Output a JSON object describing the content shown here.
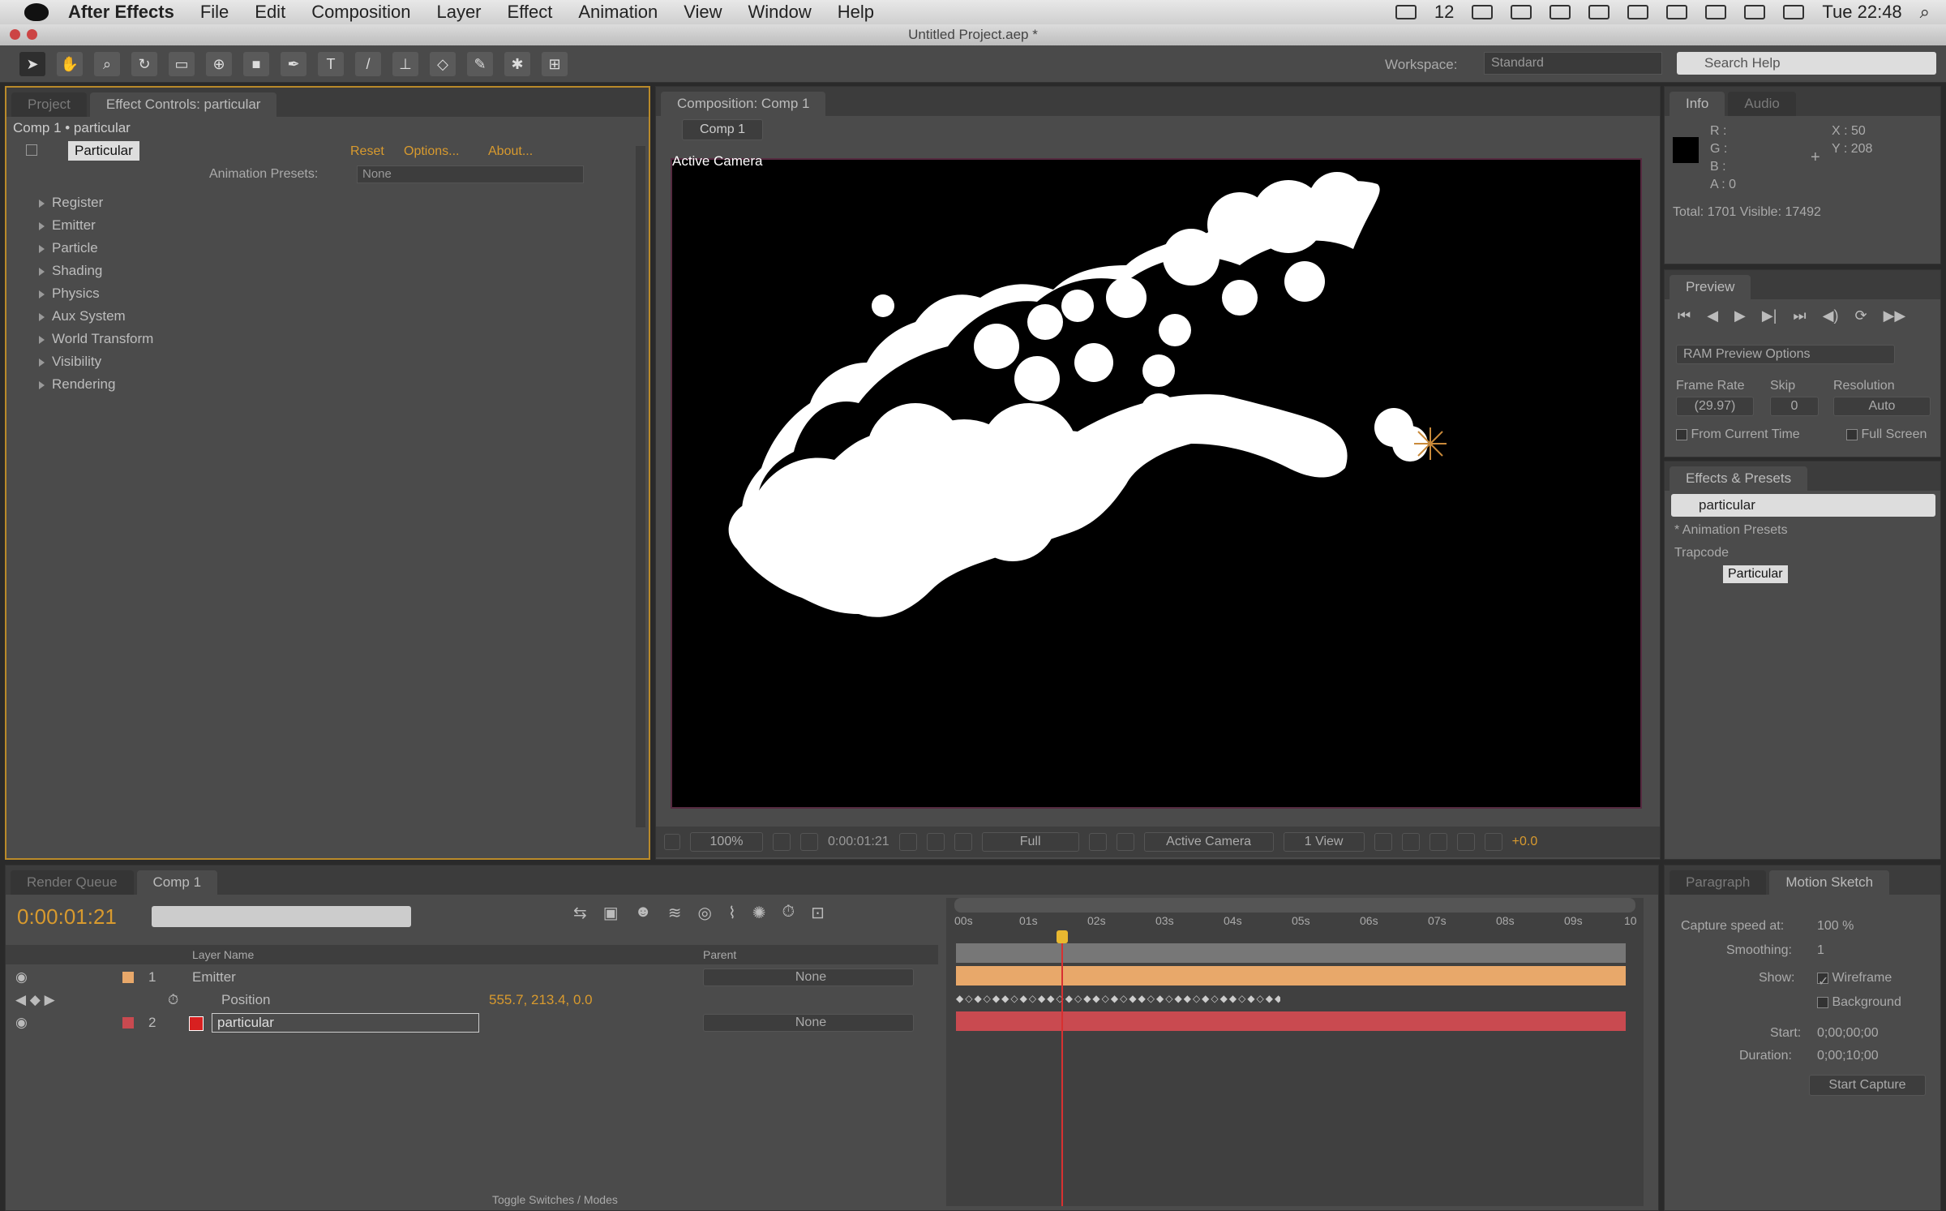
{
  "menubar": {
    "app": "After Effects",
    "items": [
      "File",
      "Edit",
      "Composition",
      "Layer",
      "Effect",
      "Animation",
      "View",
      "Window",
      "Help"
    ],
    "clock": "Tue 22:48",
    "count": "12"
  },
  "window": {
    "title": "Untitled Project.aep *"
  },
  "workspace": {
    "label": "Workspace:",
    "value": "Standard",
    "search_placeholder": "Search Help"
  },
  "left_panel": {
    "tab_project": "Project",
    "tab_effect": "Effect Controls: particular",
    "breadcrumb": "Comp 1 • particular",
    "effect_name": "Particular",
    "reset": "Reset",
    "options": "Options...",
    "about": "About...",
    "presets_label": "Animation Presets:",
    "presets_value": "None",
    "groups": [
      "Register",
      "Emitter",
      "Particle",
      "Shading",
      "Physics",
      "Aux System",
      "World Transform",
      "Visibility",
      "Rendering"
    ]
  },
  "comp_panel": {
    "tab": "Composition: Comp 1",
    "subtab": "Comp 1",
    "camera_label": "Active Camera",
    "zoom": "100%",
    "timecode": "0:00:01:21",
    "resolution": "Full",
    "camera": "Active Camera",
    "views": "1 View",
    "offset": "+0.0"
  },
  "info": {
    "tab_info": "Info",
    "tab_audio": "Audio",
    "r": "R :",
    "g": "G :",
    "b": "B :",
    "a": "A : 0",
    "x": "X : 50",
    "y": "Y : 208",
    "total": "Total: 1701   Visible: 17492"
  },
  "preview": {
    "tab": "Preview",
    "ram": "RAM Preview Options",
    "frame_rate_label": "Frame Rate",
    "skip_label": "Skip",
    "resolution_label": "Resolution",
    "frame_rate": "(29.97)",
    "skip": "0",
    "resolution": "Auto",
    "from_current": "From Current Time",
    "full_screen": "Full Screen"
  },
  "effects": {
    "tab": "Effects & Presets",
    "search": "particular",
    "anim_presets": "* Animation Presets",
    "trapcode": "Trapcode",
    "item": "Particular"
  },
  "timeline": {
    "tab_render": "Render Queue",
    "tab_comp": "Comp 1",
    "timecode": "0:00:01:21",
    "col_layer": "Layer Name",
    "col_parent": "Parent",
    "layers": [
      {
        "num": "1",
        "name": "Emitter",
        "parent": "None"
      },
      {
        "num": "2",
        "name": "particular",
        "parent": "None"
      }
    ],
    "position_label": "Position",
    "position_value": "555.7, 213.4, 0.0",
    "ruler": [
      "00s",
      "01s",
      "02s",
      "03s",
      "04s",
      "05s",
      "06s",
      "07s",
      "08s",
      "09s",
      "10"
    ],
    "toggle": "Toggle Switches / Modes"
  },
  "motion_sketch": {
    "tab_paragraph": "Paragraph",
    "tab": "Motion Sketch",
    "capture_label": "Capture speed at:",
    "capture_value": "100 %",
    "smoothing_label": "Smoothing:",
    "smoothing_value": "1",
    "show_label": "Show:",
    "wireframe": "Wireframe",
    "background": "Background",
    "start_label": "Start:",
    "start_value": "0;00;00;00",
    "duration_label": "Duration:",
    "duration_value": "0;00;10;00",
    "start_button": "Start Capture"
  },
  "colors": {
    "layer1": "#e8a86a",
    "layer2": "#c94a50",
    "playhead": "#d83030",
    "accent": "#d89a2e"
  }
}
